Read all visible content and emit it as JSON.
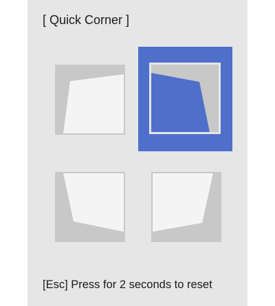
{
  "menu": {
    "title": "[ Quick Corner ]",
    "footer_hint": "[Esc] Press for 2 seconds to reset",
    "options": [
      {
        "label": "top-left",
        "selected": false
      },
      {
        "label": "top-right",
        "selected": true
      },
      {
        "label": "bottom-left",
        "selected": false
      },
      {
        "label": "bottom-right",
        "selected": false
      }
    ]
  },
  "colors": {
    "panel": "#e6e6e6",
    "highlight": "#4f6fcb",
    "shape": "#c8c8c8",
    "inner": "#f4f4f4"
  }
}
